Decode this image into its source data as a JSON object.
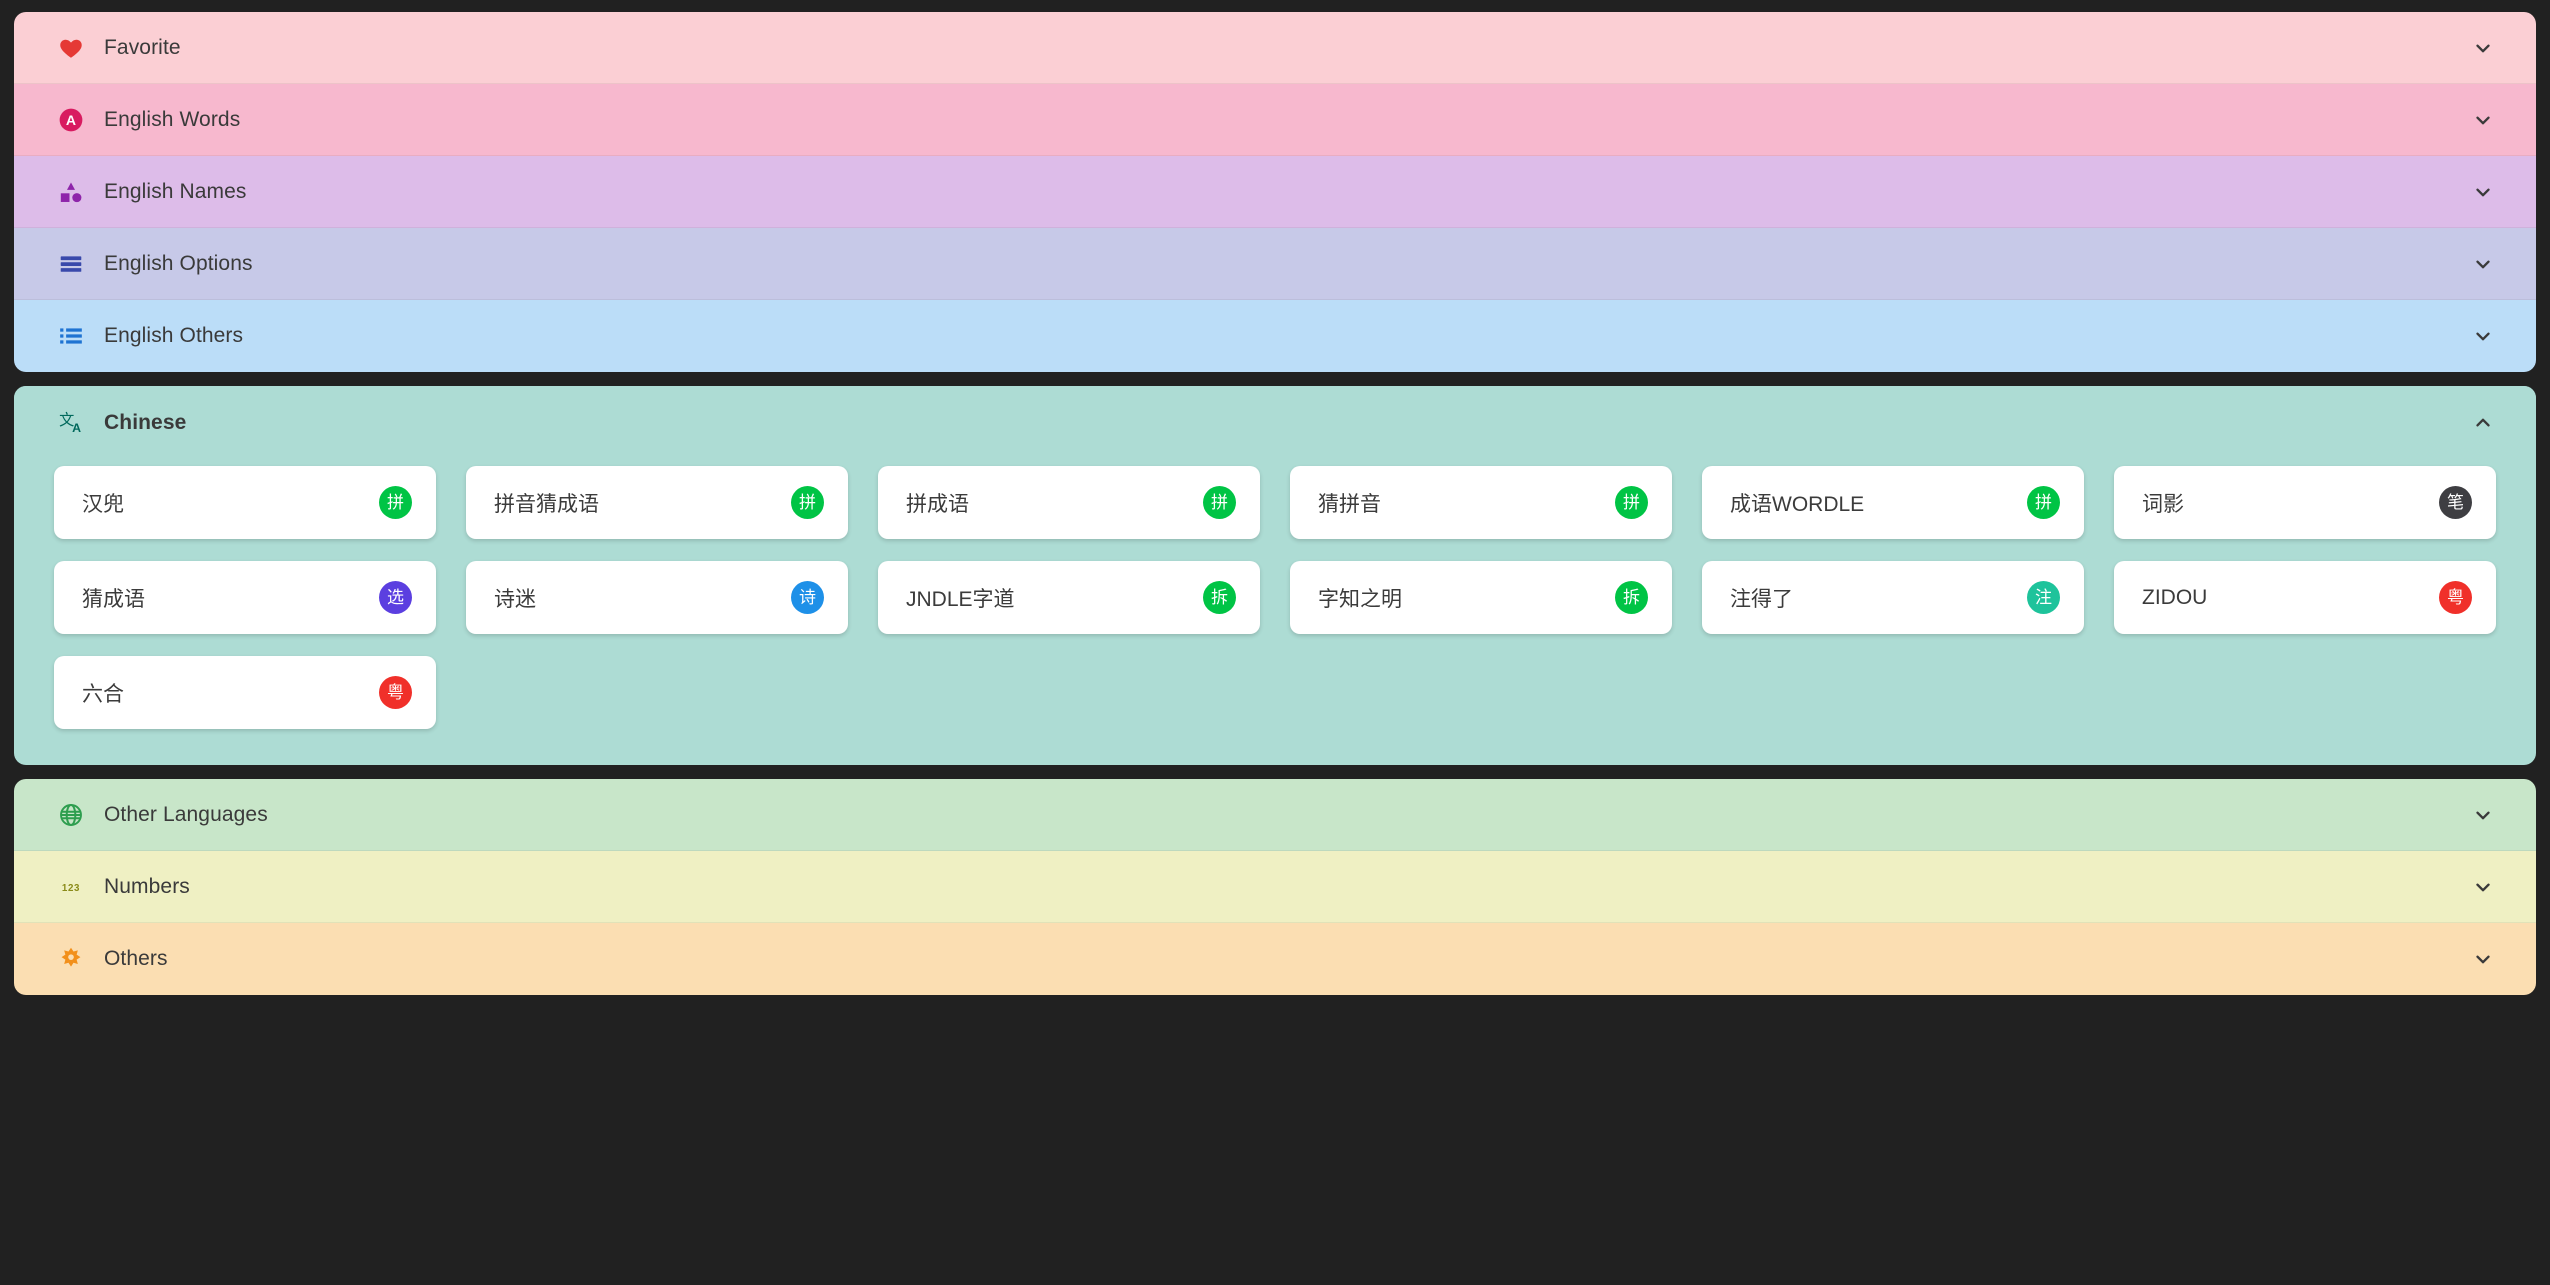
{
  "colors": {
    "page_background": "#212121",
    "favorite": "#fbcfd4",
    "english_words": "#f7b8ce",
    "english_names": "#ddbce9",
    "english_options": "#c7c9e8",
    "english_others": "#bbddf8",
    "chinese": "#addcd4",
    "other_languages": "#c8e6c9",
    "numbers": "#eff0c3",
    "others": "#fbdeb2",
    "card_background": "#ffffff",
    "text": "#3a3a3a"
  },
  "groups": [
    {
      "id": "group-top",
      "sections": [
        {
          "id": "favorite",
          "label": "Favorite",
          "icon": "heart-icon",
          "icon_color": "#e53935",
          "background": "#fbcfd4",
          "expanded": false,
          "chevron": "chevron-down-icon"
        },
        {
          "id": "english-words",
          "label": "English Words",
          "icon": "letter-a-icon",
          "icon_color": "#d81b60",
          "background": "#f7b8ce",
          "expanded": false,
          "chevron": "chevron-down-icon"
        },
        {
          "id": "english-names",
          "label": "English Names",
          "icon": "shapes-icon",
          "icon_color": "#8e24aa",
          "background": "#ddbce9",
          "expanded": false,
          "chevron": "chevron-down-icon"
        },
        {
          "id": "english-options",
          "label": "English Options",
          "icon": "bars-icon",
          "icon_color": "#3949ab",
          "background": "#c7c9e8",
          "expanded": false,
          "chevron": "chevron-down-icon"
        },
        {
          "id": "english-others",
          "label": "English Others",
          "icon": "list-icon",
          "icon_color": "#1e73d2",
          "background": "#bbddf8",
          "expanded": false,
          "chevron": "chevron-down-icon"
        }
      ]
    },
    {
      "id": "group-bottom",
      "sections": [
        {
          "id": "other-languages",
          "label": "Other Languages",
          "icon": "globe-icon",
          "icon_color": "#2e9e4f",
          "background": "#c8e6c9",
          "expanded": false,
          "chevron": "chevron-down-icon"
        },
        {
          "id": "numbers",
          "label": "Numbers",
          "icon": "one-two-three-icon",
          "icon_color": "#8a8b19",
          "background": "#eff0c3",
          "expanded": false,
          "chevron": "chevron-down-icon"
        },
        {
          "id": "others",
          "label": "Others",
          "icon": "gear-icon",
          "icon_color": "#f2901b",
          "background": "#fbdeb2",
          "expanded": false,
          "chevron": "chevron-down-icon"
        }
      ]
    }
  ],
  "chinese": {
    "id": "chinese",
    "label": "Chinese",
    "icon": "translate-icon",
    "icon_color": "#00695c",
    "background": "#addcd4",
    "expanded": true,
    "chevron": "chevron-up-icon",
    "cards": [
      {
        "title": "汉兜",
        "badge": "拼",
        "badge_color": "#00c445"
      },
      {
        "title": "拼音猜成语",
        "badge": "拼",
        "badge_color": "#00c445"
      },
      {
        "title": "拼成语",
        "badge": "拼",
        "badge_color": "#00c445"
      },
      {
        "title": "猜拼音",
        "badge": "拼",
        "badge_color": "#00c445"
      },
      {
        "title": "成语WORDLE",
        "badge": "拼",
        "badge_color": "#00c445"
      },
      {
        "title": "词影",
        "badge": "笔",
        "badge_color": "#3e3e42"
      },
      {
        "title": "猜成语",
        "badge": "选",
        "badge_color": "#5b3fe0"
      },
      {
        "title": "诗迷",
        "badge": "诗",
        "badge_color": "#1e90e8"
      },
      {
        "title": "JNDLE字道",
        "badge": "拆",
        "badge_color": "#00c445"
      },
      {
        "title": "字知之明",
        "badge": "拆",
        "badge_color": "#00c445"
      },
      {
        "title": "注得了",
        "badge": "注",
        "badge_color": "#1ec39b"
      },
      {
        "title": "ZIDOU",
        "badge": "粤",
        "badge_color": "#f0302a"
      },
      {
        "title": "六合",
        "badge": "粤",
        "badge_color": "#f0302a"
      }
    ]
  }
}
